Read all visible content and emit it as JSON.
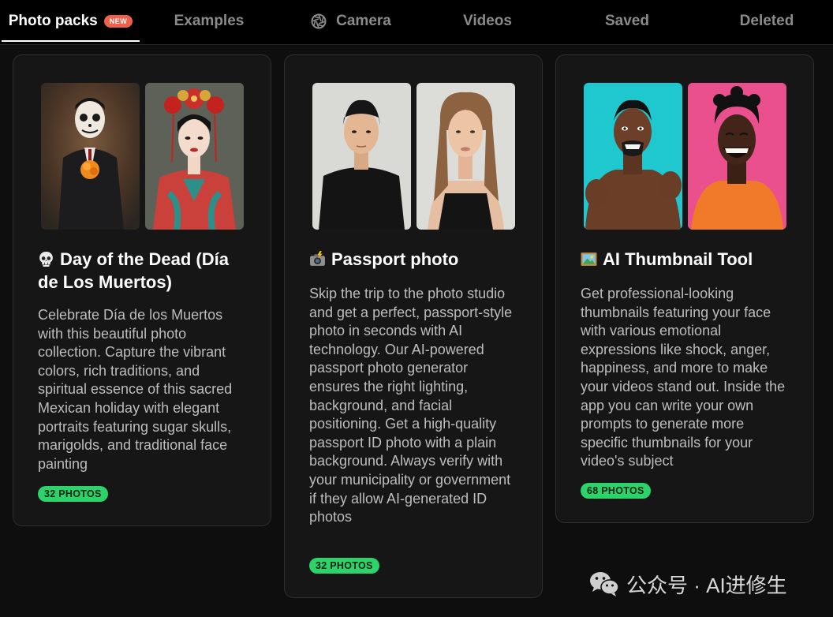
{
  "tabs": [
    {
      "label": "Photo packs",
      "badge": "NEW",
      "active": true
    },
    {
      "label": "Examples"
    },
    {
      "label": "Camera",
      "icon": "aperture-icon"
    },
    {
      "label": "Videos"
    },
    {
      "label": "Saved"
    },
    {
      "label": "Deleted"
    }
  ],
  "cards": [
    {
      "emoji": "skull-icon",
      "title": "Day of the Dead (Día de Los Muertos)",
      "description": "Celebrate Día de los Muertos with this beautiful photo collection. Capture the vibrant colors, rich traditions, and spiritual essence of this sacred Mexican holiday with elegant portraits featuring sugar skulls, marigolds, and traditional face painting",
      "badge": "32 PHOTOS"
    },
    {
      "emoji": "camera-flash-icon",
      "title": "Passport photo",
      "description": "Skip the trip to the photo studio and get a perfect, passport-style photo in seconds with AI technology. Our AI-powered passport photo generator ensures the right lighting, background, and facial positioning. Get a high-quality passport ID photo with a plain background. Always verify with your municipality or government if they allow AI-generated ID photos",
      "badge": "32 PHOTOS"
    },
    {
      "emoji": "framed-picture-icon",
      "title": "AI Thumbnail Tool",
      "description": "Get professional-looking thumbnails featuring your face with various emotional expressions like shock, anger, happiness, and more to make your videos stand out. Inside the app you can write your own prompts to generate more specific thumbnails for your video's subject",
      "badge": "68 PHOTOS"
    }
  ],
  "watermark": {
    "text": "公众号 · AI进修生",
    "icon": "wechat-icon"
  },
  "colors": {
    "accent_green": "#2bd36a",
    "new_badge": "#f0614d",
    "card_bg": "#161616",
    "page_bg": "#0e0e0e"
  }
}
